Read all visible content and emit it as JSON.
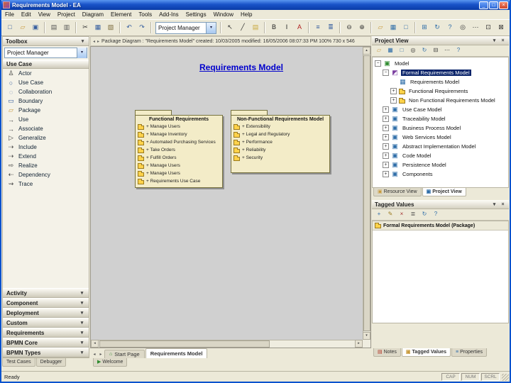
{
  "window": {
    "title": "Requirements Model - EA"
  },
  "titlebar": {
    "buttons": [
      {
        "name": "minimize",
        "glyph": "_"
      },
      {
        "name": "maximize",
        "glyph": "□"
      },
      {
        "name": "close",
        "glyph": "×"
      }
    ]
  },
  "menu": {
    "items": [
      "File",
      "Edit",
      "View",
      "Project",
      "Diagram",
      "Element",
      "Tools",
      "Add-Ins",
      "Settings",
      "Window",
      "Help"
    ]
  },
  "toolbar": {
    "items": [
      {
        "t": "i",
        "n": "new-document"
      },
      {
        "t": "i",
        "n": "open-file"
      },
      {
        "t": "i",
        "n": "save"
      },
      {
        "t": "s"
      },
      {
        "t": "i",
        "n": "print"
      },
      {
        "t": "i",
        "n": "print-preview"
      },
      {
        "t": "s"
      },
      {
        "t": "i",
        "n": "cut"
      },
      {
        "t": "i",
        "n": "copy"
      },
      {
        "t": "i",
        "n": "paste"
      },
      {
        "t": "s"
      },
      {
        "t": "i",
        "n": "undo"
      },
      {
        "t": "i",
        "n": "redo"
      },
      {
        "t": "s"
      },
      {
        "t": "c",
        "v": "Project Manager"
      },
      {
        "t": "s"
      },
      {
        "t": "i",
        "n": "pointer"
      },
      {
        "t": "i",
        "n": "draw-line"
      },
      {
        "t": "i",
        "n": "note"
      },
      {
        "t": "s"
      },
      {
        "t": "i",
        "n": "bold"
      },
      {
        "t": "i",
        "n": "italic"
      },
      {
        "t": "i",
        "n": "font-color"
      },
      {
        "t": "s"
      },
      {
        "t": "i",
        "n": "align-left"
      },
      {
        "t": "i",
        "n": "bullet-list"
      },
      {
        "t": "s"
      },
      {
        "t": "i",
        "n": "zoom-out"
      },
      {
        "t": "i",
        "n": "zoom-in"
      },
      {
        "t": "s"
      },
      {
        "t": "i",
        "n": "new-package"
      },
      {
        "t": "i",
        "n": "new-diagram"
      },
      {
        "t": "i",
        "n": "new-element"
      },
      {
        "t": "s"
      },
      {
        "t": "i",
        "n": "project-tree"
      },
      {
        "t": "i",
        "n": "refresh"
      },
      {
        "t": "i",
        "n": "help"
      },
      {
        "t": "sp"
      },
      {
        "t": "i",
        "n": "model-search"
      },
      {
        "t": "i",
        "n": "options"
      },
      {
        "t": "i",
        "n": "window-manager"
      },
      {
        "t": "i",
        "n": "fullscreen"
      },
      {
        "t": "i",
        "n": "dock-panels"
      },
      {
        "t": "i",
        "n": "more-tools"
      }
    ]
  },
  "toolbox": {
    "title": "Toolbox",
    "combo_value": "Project Manager",
    "section": "Use Case",
    "items": [
      {
        "label": "Actor",
        "icon": "actor"
      },
      {
        "label": "Use Case",
        "icon": "use-case"
      },
      {
        "label": "Collaboration",
        "icon": "collaboration"
      },
      {
        "label": "Boundary",
        "icon": "boundary"
      },
      {
        "label": "Package",
        "icon": "package-tool"
      },
      {
        "label": "Use",
        "icon": "use"
      },
      {
        "label": "Associate",
        "icon": "associate"
      },
      {
        "label": "Generalize",
        "icon": "generalize"
      },
      {
        "label": "Include",
        "icon": "include"
      },
      {
        "label": "Extend",
        "icon": "extend"
      },
      {
        "label": "Realize",
        "icon": "realize"
      },
      {
        "label": "Dependency",
        "icon": "dependency"
      },
      {
        "label": "Trace",
        "icon": "trace"
      }
    ],
    "sections_bottom": [
      "Activity",
      "Component",
      "Deployment",
      "Custom",
      "Requirements",
      "BPMN Core",
      "BPMN Types"
    ]
  },
  "canvas": {
    "info": "Package Diagram : \"Requirements Model\"  created: 10/03/2005  modified: 16/05/2006 08:07:33 PM  100%  730 x 546",
    "title": "Requirements Model",
    "packages": [
      {
        "name": "Functional Requirements",
        "items": [
          "+ Manage Users",
          "+ Manage Inventory",
          "+ Automated Purchasing Services",
          "+ Take Orders",
          "+ Fulfill Orders",
          "+ Manage Users",
          "+ Manage Users",
          "+ Requirements Use Case"
        ]
      },
      {
        "name": "Non-Functional Requirements Model",
        "items": [
          "+ Extensibility",
          "+ Legal and Regulatory",
          "+ Performance",
          "+ Reliability",
          "+ Security"
        ]
      }
    ],
    "tabs": [
      {
        "label": "Start Page",
        "icon": "home"
      },
      {
        "label": "Requirements Model",
        "active": true
      }
    ]
  },
  "project_view": {
    "title": "Project View",
    "toolbar": [
      "new-package",
      "new-diagram",
      "new-element",
      "find-in-browser",
      "refresh-view",
      "collapse-all",
      "browser-options",
      "help"
    ],
    "tree": [
      {
        "label": "Model",
        "depth": 0,
        "exp": "minus",
        "icon": "model"
      },
      {
        "label": "Formal Requirements Model",
        "depth": 1,
        "exp": "minus",
        "icon": "view",
        "selected": true
      },
      {
        "label": "Requirements Model",
        "depth": 2,
        "exp": "none",
        "icon": "diagram"
      },
      {
        "label": "Functional Requirements",
        "depth": 2,
        "exp": "plus",
        "icon": "folder"
      },
      {
        "label": "Non Functional Requirements Model",
        "depth": 2,
        "exp": "plus",
        "icon": "folder"
      },
      {
        "label": "Use Case Model",
        "depth": 1,
        "exp": "plus",
        "icon": "package"
      },
      {
        "label": "Traceability Model",
        "depth": 1,
        "exp": "plus",
        "icon": "package"
      },
      {
        "label": "Business Process Model",
        "depth": 1,
        "exp": "plus",
        "icon": "package"
      },
      {
        "label": "Web Services Model",
        "depth": 1,
        "exp": "plus",
        "icon": "package"
      },
      {
        "label": "Abstract Implementation Model",
        "depth": 1,
        "exp": "plus",
        "icon": "package"
      },
      {
        "label": "Code Model",
        "depth": 1,
        "exp": "plus",
        "icon": "package"
      },
      {
        "label": "Persistence Model",
        "depth": 1,
        "exp": "plus",
        "icon": "package"
      },
      {
        "label": "Components",
        "depth": 1,
        "exp": "plus",
        "icon": "package"
      }
    ],
    "tabs": [
      {
        "label": "Resource View",
        "icon": "resource"
      },
      {
        "label": "Project View",
        "icon": "project",
        "active": true
      }
    ]
  },
  "tagged_values": {
    "title": "Tagged Values",
    "toolbar": [
      "new-tagged-value",
      "edit-tagged-value",
      "delete-tagged-value",
      "sort-tags",
      "refresh-tags",
      "help"
    ],
    "caption": "Formal Requirements Model (Package)",
    "tabs": [
      {
        "label": "Notes",
        "icon": "notes"
      },
      {
        "label": "Tagged Values",
        "icon": "tagged",
        "active": true
      },
      {
        "label": "Properties",
        "icon": "properties"
      }
    ]
  },
  "bottom": {
    "left_tabs": [
      {
        "label": "Test Cases"
      },
      {
        "label": "Debugger"
      }
    ],
    "welcome_tab": {
      "label": "Welcome",
      "icon": "play"
    }
  },
  "status": {
    "message": "Ready",
    "cells": [
      "CAP",
      "NUM",
      "SCRL"
    ]
  }
}
